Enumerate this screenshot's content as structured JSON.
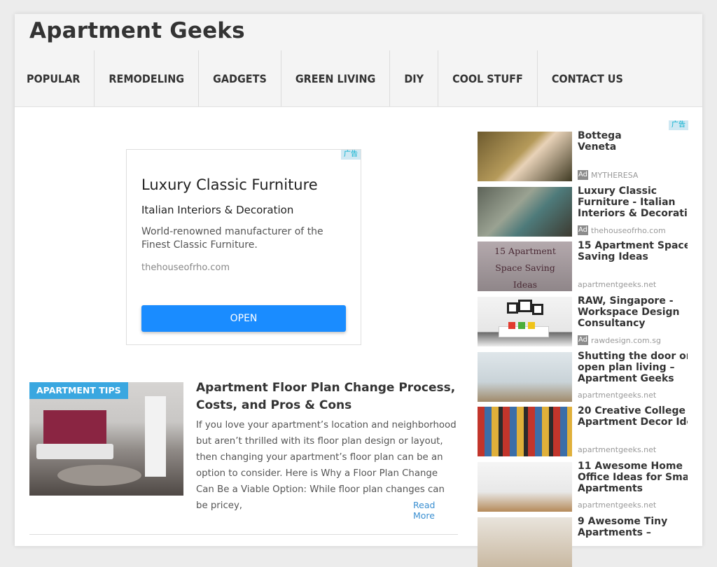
{
  "site": {
    "title": "Apartment Geeks"
  },
  "nav": [
    "POPULAR",
    "REMODELING",
    "GADGETS",
    "GREEN LIVING",
    "DIY",
    "COOL STUFF",
    "CONTACT US"
  ],
  "main_ad": {
    "badge": "广告",
    "title": "Luxury Classic Furniture",
    "subtitle": "Italian Interiors & Decoration",
    "description": "World-renowned manufacturer of the Finest Classic Furniture.",
    "url": "thehouseofrho.com",
    "button": "OPEN"
  },
  "post": {
    "category": "APARTMENT TIPS",
    "title": "Apartment Floor Plan Change Process, Costs, and Pros & Cons",
    "excerpt": "If you love your apartment’s location and neighborhood but aren’t thrilled with its floor plan design or layout, then changing your apartment’s floor plan can be an option to consider. Here is Why a Floor Plan Change Can Be a Viable Option: While floor plan changes can be pricey,",
    "read_more": "Read More"
  },
  "sidebar": {
    "badge": "广告",
    "ad_tag": "Ad",
    "items": [
      {
        "title_lines": [
          "Bottega",
          "Veneta"
        ],
        "source": "MYTHERESA",
        "is_ad": true
      },
      {
        "title_lines": [
          "Luxury Classic",
          "Furniture - Italian",
          "Interiors & Decorati"
        ],
        "source": "thehouseofrho.com",
        "is_ad": true
      },
      {
        "title_lines": [
          "15 Apartment Space",
          "Saving Ideas"
        ],
        "source": "apartmentgeeks.net",
        "is_ad": false,
        "thumb_text": [
          "15 Apartment",
          "Space Saving",
          "Ideas"
        ]
      },
      {
        "title_lines": [
          "RAW, Singapore -",
          "Workspace Design",
          "Consultancy"
        ],
        "source": "rawdesign.com.sg",
        "is_ad": true
      },
      {
        "title_lines": [
          "Shutting the door on",
          "open plan living –",
          "Apartment Geeks"
        ],
        "source": "apartmentgeeks.net",
        "is_ad": false
      },
      {
        "title_lines": [
          "20 Creative College",
          "Apartment Decor Ide"
        ],
        "source": "apartmentgeeks.net",
        "is_ad": false
      },
      {
        "title_lines": [
          "11 Awesome Home",
          "Office Ideas for Sma",
          "Apartments"
        ],
        "source": "apartmentgeeks.net",
        "is_ad": false
      },
      {
        "title_lines": [
          "9 Awesome Tiny",
          "Apartments –"
        ],
        "source": "",
        "is_ad": false
      }
    ]
  }
}
